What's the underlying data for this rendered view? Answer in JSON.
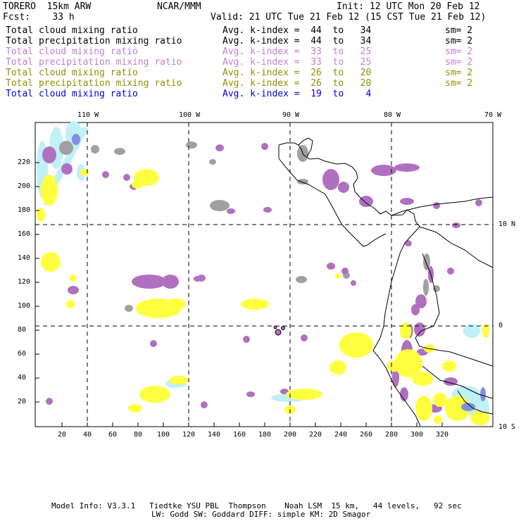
{
  "header": {
    "model": "TORERO  15km ARW",
    "org": "NCAR/MMM",
    "init": "Init: 12 UTC Mon 20 Feb 12",
    "fcst": "Fcst:    33 h",
    "valid": "Valid: 21 UTC Tue 21 Feb 12 (15 CST Tue 21 Feb 12)"
  },
  "legend": [
    {
      "field": "Total cloud mixing ratio",
      "index": "Avg. k-index =  44  to   34",
      "sm": "sm= 2",
      "color": "#000000"
    },
    {
      "field": "Total precipitation mixing ratio",
      "index": "Avg. k-index =  44  to   34",
      "sm": "sm= 2",
      "color": "#000000"
    },
    {
      "field": "Total cloud mixing ratio",
      "index": "Avg. k-index =  33  to   25",
      "sm": "sm= 2",
      "color": "#c080d0"
    },
    {
      "field": "Total precipitation mixing ratio",
      "index": "Avg. k-index =  33  to   25",
      "sm": "sm= 2",
      "color": "#c080d0"
    },
    {
      "field": "Total cloud mixing ratio",
      "index": "Avg. k-index =  26  to   20",
      "sm": "sm= 2",
      "color": "#909000"
    },
    {
      "field": "Total precipitation mixing ratio",
      "index": "Avg. k-index =  26  to   20",
      "sm": "sm= 2",
      "color": "#909000"
    },
    {
      "field": "Total cloud mixing ratio",
      "index": "Avg. k-index =  19  to    4",
      "sm": "",
      "color": "#0000e0"
    }
  ],
  "top_lon_labels": [
    "110 W",
    "100 W",
    "90 W",
    "80 W",
    "70 W"
  ],
  "right_lat_labels": [
    "10 N",
    "0",
    "10 S"
  ],
  "y_ticks": [
    20,
    40,
    60,
    80,
    100,
    120,
    140,
    160,
    180,
    200,
    220
  ],
  "x_ticks": [
    20,
    40,
    60,
    80,
    100,
    120,
    140,
    160,
    180,
    200,
    220,
    240,
    260,
    280,
    300,
    320
  ],
  "footer": {
    "line1": "Model Info: V3.3.1   Tiedtke YSU PBL  Thompson    Noah LSM  15 km,   44 levels,   92 sec",
    "line2": "LW: Godd SW: Goddard DIFF: simple KM: 2D Smagor"
  },
  "colors": {
    "gray": "#a0a0a0",
    "purple": "#b070c0",
    "yellow": "#ffff40",
    "cyan": "#c0f0f8",
    "blue": "#8090e0"
  }
}
